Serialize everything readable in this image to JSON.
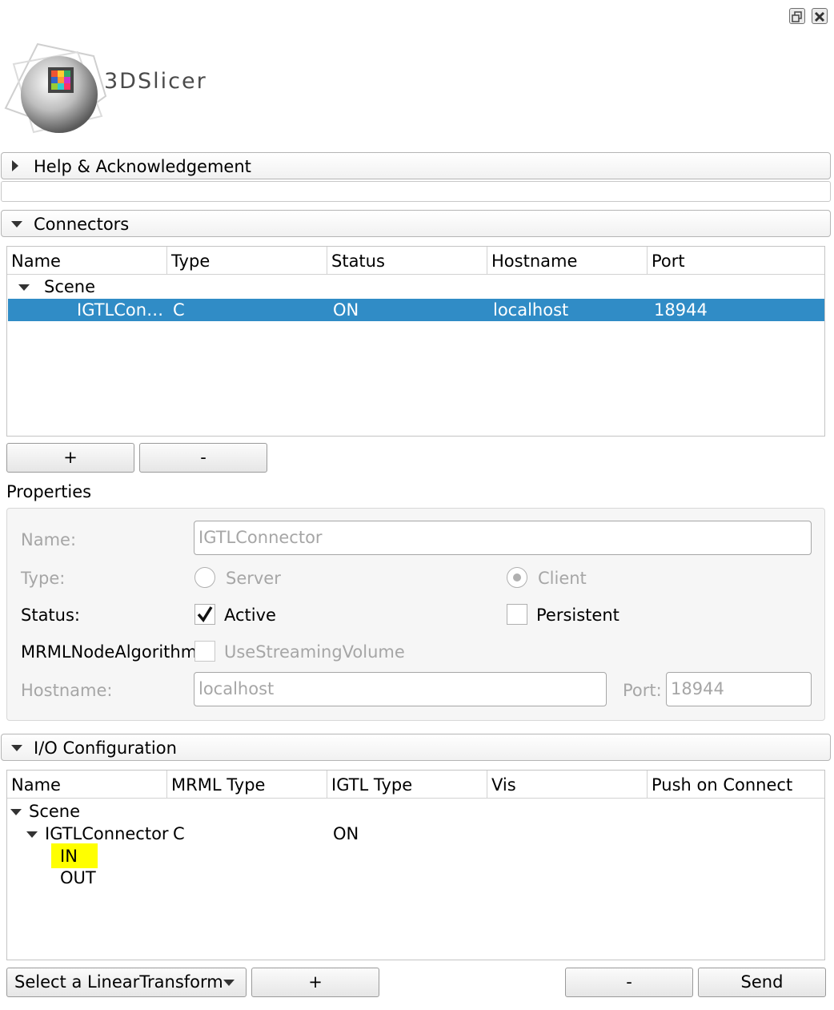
{
  "logo": {
    "text": "3DSlicer"
  },
  "sections": {
    "help": "Help & Acknowledgement",
    "connectors": "Connectors",
    "io": "I/O Configuration"
  },
  "connectors_table": {
    "headers": [
      "Name",
      "Type",
      "Status",
      "Hostname",
      "Port"
    ],
    "scene": "Scene",
    "row": {
      "name": "IGTLCon…",
      "type": "C",
      "status": "ON",
      "hostname": "localhost",
      "port": "18944"
    }
  },
  "connector_buttons": {
    "add": "+",
    "remove": "-"
  },
  "properties": {
    "heading": "Properties",
    "name_label": "Name:",
    "name_value": "IGTLConnector",
    "type_label": "Type:",
    "server": "Server",
    "client": "Client",
    "status_label": "Status:",
    "active": "Active",
    "persistent": "Persistent",
    "algo_label": "MRMLNodeAlgorithm:",
    "streaming": "UseStreamingVolume",
    "hostname_label": "Hostname:",
    "hostname_value": "localhost",
    "port_label": "Port:",
    "port_value": "18944"
  },
  "io_table": {
    "headers": [
      "Name",
      "MRML Type",
      "IGTL Type",
      "Vis",
      "Push on Connect"
    ],
    "scene": "Scene",
    "connector": {
      "name": "IGTLConnector",
      "mrml": "C",
      "igtl": "ON"
    },
    "in": "IN",
    "out": "OUT"
  },
  "bottom_bar": {
    "select": "Select a LinearTransform",
    "add": "+",
    "remove": "-",
    "send": "Send"
  },
  "colors": {
    "selection": "#308cc6",
    "highlight": "#ffff00"
  }
}
